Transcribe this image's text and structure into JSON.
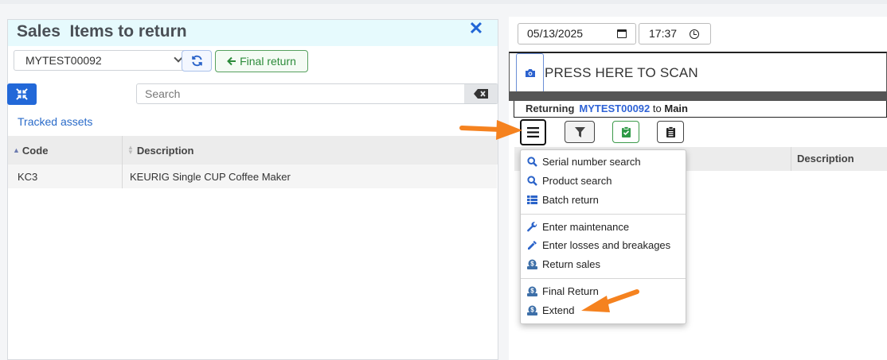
{
  "left_panel": {
    "title": "Sales  Items to return",
    "order_select_value": "MYTEST00092",
    "final_return_label": "Final return",
    "search_placeholder": "Search",
    "tracked_assets_label": "Tracked assets",
    "table": {
      "headers": [
        "Code",
        "Description"
      ],
      "rows": [
        {
          "code": "KC3",
          "description": "KEURIG Single CUP Coffee Maker"
        }
      ]
    }
  },
  "right_panel": {
    "date_value": "05/13/2025",
    "time_value": "17:37",
    "scan_label": "PRESS HERE TO SCAN",
    "returning": {
      "prefix": "Returning",
      "order": "MYTEST00092",
      "to_word": "to",
      "location": "Main"
    },
    "table_header_description": "Description"
  },
  "menu": {
    "items": [
      {
        "label": "Serial number search",
        "icon": "search-icon"
      },
      {
        "label": "Product search",
        "icon": "search-icon"
      },
      {
        "label": "Batch return",
        "icon": "table-icon"
      },
      {
        "label": "Enter maintenance",
        "icon": "wrench-icon"
      },
      {
        "label": "Enter losses and breakages",
        "icon": "eyedropper-icon"
      },
      {
        "label": "Return sales",
        "icon": "dollar-icon"
      },
      {
        "label": "Final Return",
        "icon": "dollar-icon"
      },
      {
        "label": "Extend",
        "icon": "dollar-icon"
      }
    ]
  },
  "colors": {
    "accent_blue": "#2268d8",
    "link_blue": "#2a6bc9",
    "success_green": "#2c8b3a",
    "annotation_orange": "#f5821f",
    "header_tint": "#e6fafd"
  }
}
